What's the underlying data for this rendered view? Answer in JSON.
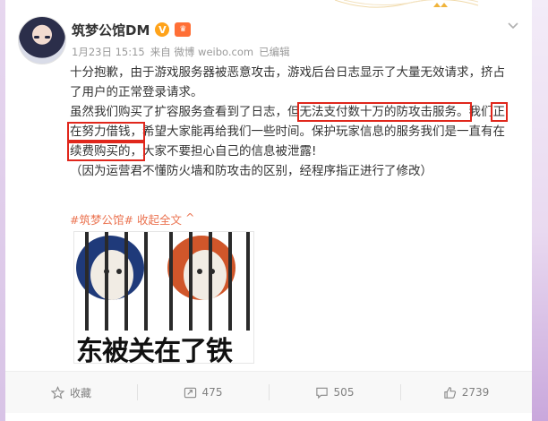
{
  "post": {
    "author": "筑梦公馆DM",
    "verified_mark": "V",
    "vip_badge": "♛",
    "date": "1月23日 15:15",
    "via": "来自 微博 weibo.com",
    "edited": "已编辑",
    "paragraph1": "十分抱歉，由于游戏服务器被恶意攻击，游戏后台日志显示了大量无效请求，挤占了用户的正常登录请求。",
    "p2_part1": "虽然我们购买了扩容服务查看到了日志，但",
    "p2_hl1": "无法支付数十万的防攻击服务。",
    "p2_part2": "我们",
    "p2_hl2": "正在努力借钱，",
    "p2_part3": "希望大家能再给我们一些时间。保护玩家信息的服务我们是一直有在",
    "p2_hl3": "续费购买的，",
    "p2_part4": "大家不要担心自己的信息被泄露!",
    "paragraph3": "（因为运营君不懂防火墙和防攻击的区别，经程序指正进行了修改）",
    "topic": "#筑梦公馆#",
    "collapse": "收起全文",
    "collapse_arrow": "^"
  },
  "meme": {
    "caption": "东被关在了铁"
  },
  "actions": {
    "favorite": "收藏",
    "repost": "475",
    "comment": "505",
    "like": "2739"
  },
  "colors": {
    "highlight": "#e0271c",
    "link": "#eb7350",
    "verified": "#ffa31a"
  }
}
